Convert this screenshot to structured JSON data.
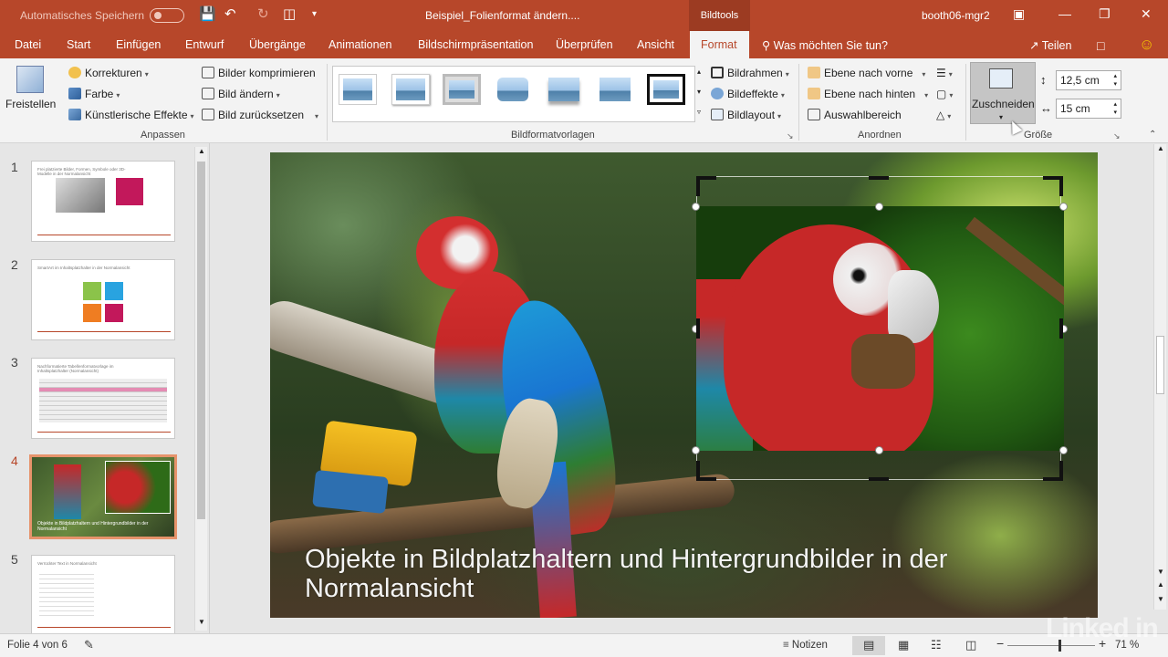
{
  "titlebar": {
    "autosave": "Automatisches Speichern",
    "document_title": "Beispiel_Folienformat ändern....",
    "context_tab_group": "Bildtools",
    "user": "booth06-mgr2"
  },
  "tabs": [
    "Datei",
    "Start",
    "Einfügen",
    "Entwurf",
    "Übergänge",
    "Animationen",
    "Bildschirmpräsentation",
    "Überprüfen",
    "Ansicht",
    "Format"
  ],
  "active_tab": "Format",
  "tell_me": "Was möchten Sie tun?",
  "share": "Teilen",
  "ribbon": {
    "freistellen": "Freistellen",
    "korrekturen": "Korrekturen",
    "farbe": "Farbe",
    "kuenstlerische_effekte": "Künstlerische Effekte",
    "bilder_komprimieren": "Bilder komprimieren",
    "bild_aendern": "Bild ändern",
    "bild_zuruecksetzen": "Bild zurücksetzen",
    "group_anpassen": "Anpassen",
    "group_bildformatvorlagen": "Bildformatvorlagen",
    "bildrahmen": "Bildrahmen",
    "bildeffekte": "Bildeffekte",
    "bildlayout": "Bildlayout",
    "ebene_vorne": "Ebene nach vorne",
    "ebene_hinten": "Ebene nach hinten",
    "auswahlbereich": "Auswahlbereich",
    "group_anordnen": "Anordnen",
    "zuschneiden": "Zuschneiden",
    "hoehe": "12,5 cm",
    "breite": "15 cm",
    "group_groesse": "Größe"
  },
  "thumbnails": [
    {
      "num": "1",
      "text": "Frei platzierte Bilder, Formen, Symbole oder 3D-Modelle in der Normalansicht"
    },
    {
      "num": "2",
      "text": "SmartArt im Inhaltsplatzhalter in der Normalansicht"
    },
    {
      "num": "3",
      "text": "Nachformatierte Tabellenformatvorlage im Inhaltsplatzhalter (Normalansicht)"
    },
    {
      "num": "4",
      "text": "Objekte in Bildplatzhaltern und Hintergrundbilder in der Normalansicht"
    },
    {
      "num": "5",
      "text": "Verrückter Text in Normalansicht"
    }
  ],
  "active_slide": 4,
  "slide": {
    "title": "Objekte in Bildplatzhaltern und Hintergrundbilder in der Normalansicht"
  },
  "statusbar": {
    "slide_info": "Folie 4 von 6",
    "notes": "Notizen",
    "zoom": "71 %"
  },
  "watermark": "Linked in",
  "colors": {
    "accent": "#b7472a",
    "ribbon_bg": "#f3f3f3"
  }
}
